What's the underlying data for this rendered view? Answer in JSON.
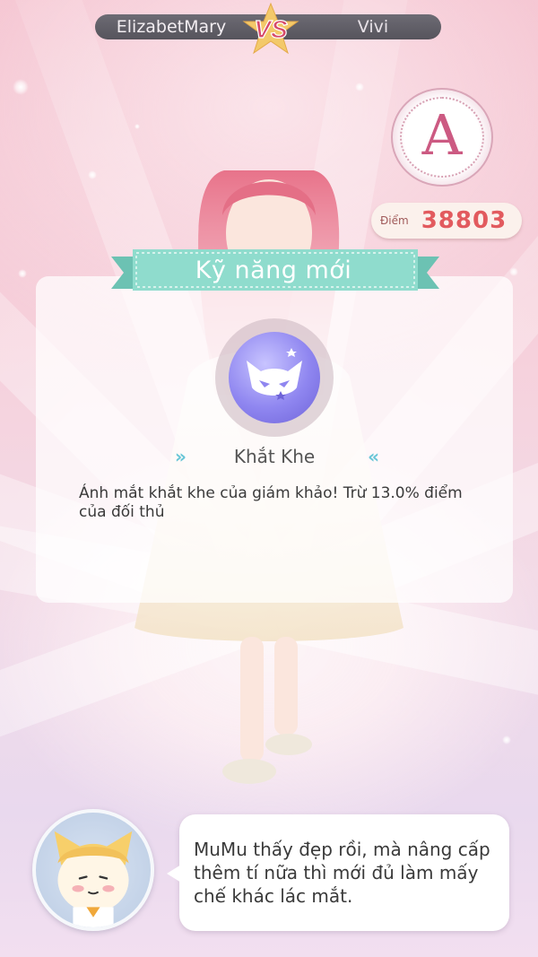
{
  "header": {
    "player_left": "ElizabetMary",
    "player_right": "Vivi",
    "vs_label": "VS"
  },
  "result": {
    "rank": "A",
    "score_label": "Điểm",
    "score_value": "38803"
  },
  "skill_panel": {
    "title": "Kỹ năng mới",
    "skill_icon": "cat-mask-icon",
    "skill_name": "Khắt Khe",
    "chevron_left": "»",
    "chevron_right": "«",
    "description": "Ánh mắt khắt khe của giám khảo! Trừ 13.0% điểm của đối thủ"
  },
  "mascot": {
    "icon": "mumu-cat-avatar",
    "speech": "MuMu thấy đẹp rồi, mà nâng cấp thêm tí nữa thì mới đủ làm mấy chế khác lác mắt."
  },
  "colors": {
    "accent_teal": "#66c5d6",
    "ribbon_teal": "#7fd3c4",
    "score_red": "#e25a5e",
    "rank_pink": "#cc5a82"
  }
}
